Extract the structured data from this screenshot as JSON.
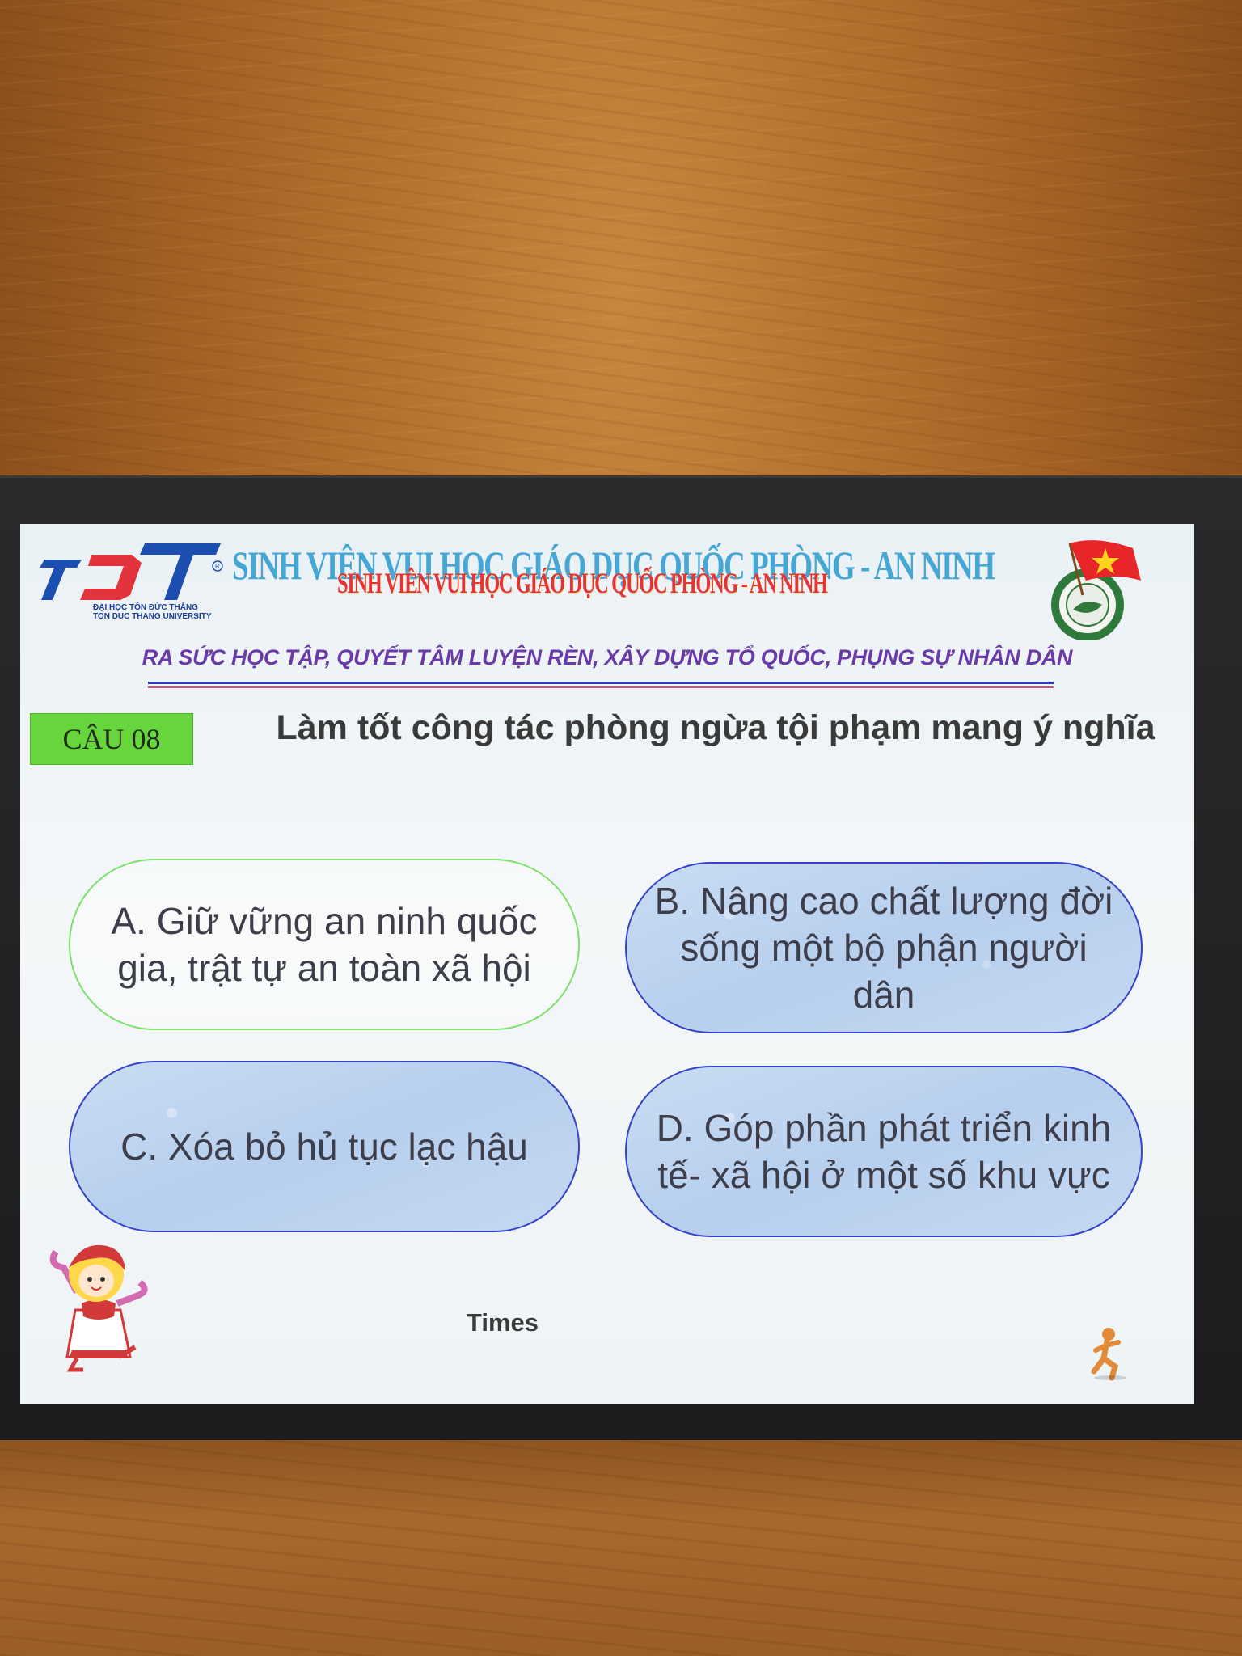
{
  "header": {
    "logo_text": "TDT",
    "university_name_vi": "ĐẠI HỌC TÔN ĐỨC THẮNG",
    "university_name_en": "TON DUC THANG UNIVERSITY",
    "title_back": "SINH VIÊN VUI HỌC GIÁO DỤC QUỐC PHÒNG - AN NINH",
    "title_front": "SINH VIÊN VUI HỌC GIÁO DỤC QUỐC PHÒNG - AN NINH",
    "slogan": "RA SỨC HỌC TẬP, QUYẾT TÂM LUYỆN RÈN, XÂY DỰNG TỔ QUỐC, PHỤNG SỰ NHÂN DÂN"
  },
  "question": {
    "number_label": "CÂU 08",
    "text": "Làm tốt công tác phòng ngừa tội phạm mang ý nghĩa"
  },
  "answers": [
    {
      "label": "A. Giữ vững an ninh quốc gia, trật tự an toàn xã hội"
    },
    {
      "label": "B. Nâng cao chất lượng đời sống một bộ phận người dân"
    },
    {
      "label": "C. Xóa bỏ hủ tục lạc hậu"
    },
    {
      "label": "D. Góp phần phát triển kinh tế- xã hội ở một số khu vực"
    }
  ],
  "footer": {
    "timer_label": "Times"
  },
  "colors": {
    "badge_green": "#66d63c",
    "answer_blue": "#b7cfee",
    "answer_border": "#3443c9",
    "selected_border": "#7fe06a",
    "title_red": "#e3343d",
    "title_blue": "#2a9ad0",
    "slogan_purple": "#6a3aa8",
    "flag_red": "#e8262a",
    "flag_star": "#ffd21e"
  },
  "icons": {
    "mascot": "cartoon-girl-icon",
    "runner": "running-figure-icon",
    "emblem": "youth-union-emblem-icon"
  }
}
